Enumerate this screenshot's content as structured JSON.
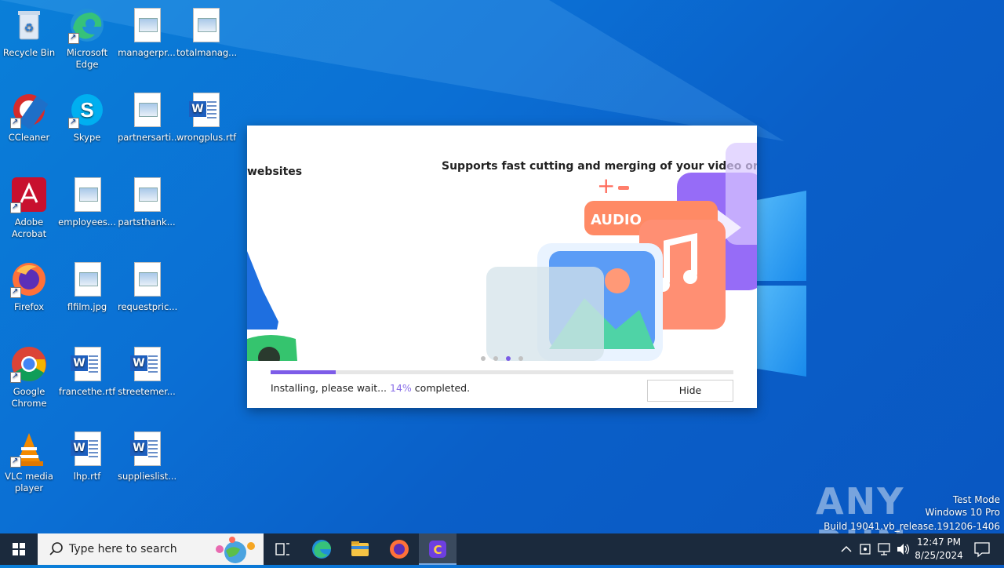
{
  "desktop": {
    "icons": [
      {
        "label": "Recycle Bin",
        "icon": "recycle-bin-icon"
      },
      {
        "label": "Microsoft Edge",
        "icon": "edge-icon"
      },
      {
        "label": "managerpr...",
        "icon": "image-file-icon"
      },
      {
        "label": "totalmanag...",
        "icon": "image-file-icon"
      },
      {
        "label": "CCleaner",
        "icon": "ccleaner-icon"
      },
      {
        "label": "Skype",
        "icon": "skype-icon"
      },
      {
        "label": "partnersarti...",
        "icon": "image-file-icon"
      },
      {
        "label": "wrongplus.rtf",
        "icon": "word-doc-icon"
      },
      {
        "label": "Adobe Acrobat",
        "icon": "acrobat-icon"
      },
      {
        "label": "employees...",
        "icon": "image-file-icon"
      },
      {
        "label": "partsthank...",
        "icon": "image-file-icon"
      },
      {
        "label": "Firefox",
        "icon": "firefox-icon"
      },
      {
        "label": "flfilm.jpg",
        "icon": "image-file-icon"
      },
      {
        "label": "requestpric...",
        "icon": "image-file-icon"
      },
      {
        "label": "Google Chrome",
        "icon": "chrome-icon"
      },
      {
        "label": "francethe.rtf",
        "icon": "word-doc-icon"
      },
      {
        "label": "streetemer...",
        "icon": "word-doc-icon"
      },
      {
        "label": "VLC media player",
        "icon": "vlc-icon"
      },
      {
        "label": "lhp.rtf",
        "icon": "word-doc-icon"
      },
      {
        "label": "supplieslist...",
        "icon": "word-doc-icon"
      }
    ]
  },
  "installer": {
    "slide_prev_title": "websites",
    "slide_title": "Supports fast cutting and merging of your video or au",
    "audio_badge": "AUDIO",
    "dots_active_index": 2,
    "progress_percent": 14,
    "status_prefix": "Installing, please wait...",
    "status_percent": "14%",
    "status_suffix": "completed.",
    "hide_label": "Hide",
    "accent_color": "#7d5ce8"
  },
  "taskbar": {
    "search_placeholder": "Type here to search",
    "time": "12:47 PM",
    "date": "8/25/2024"
  },
  "watermark": {
    "mode": "Test Mode",
    "edition": "Windows 10 Pro",
    "build": "Build 19041.vb_release.191206-1406",
    "brand": "ANY RUN"
  }
}
